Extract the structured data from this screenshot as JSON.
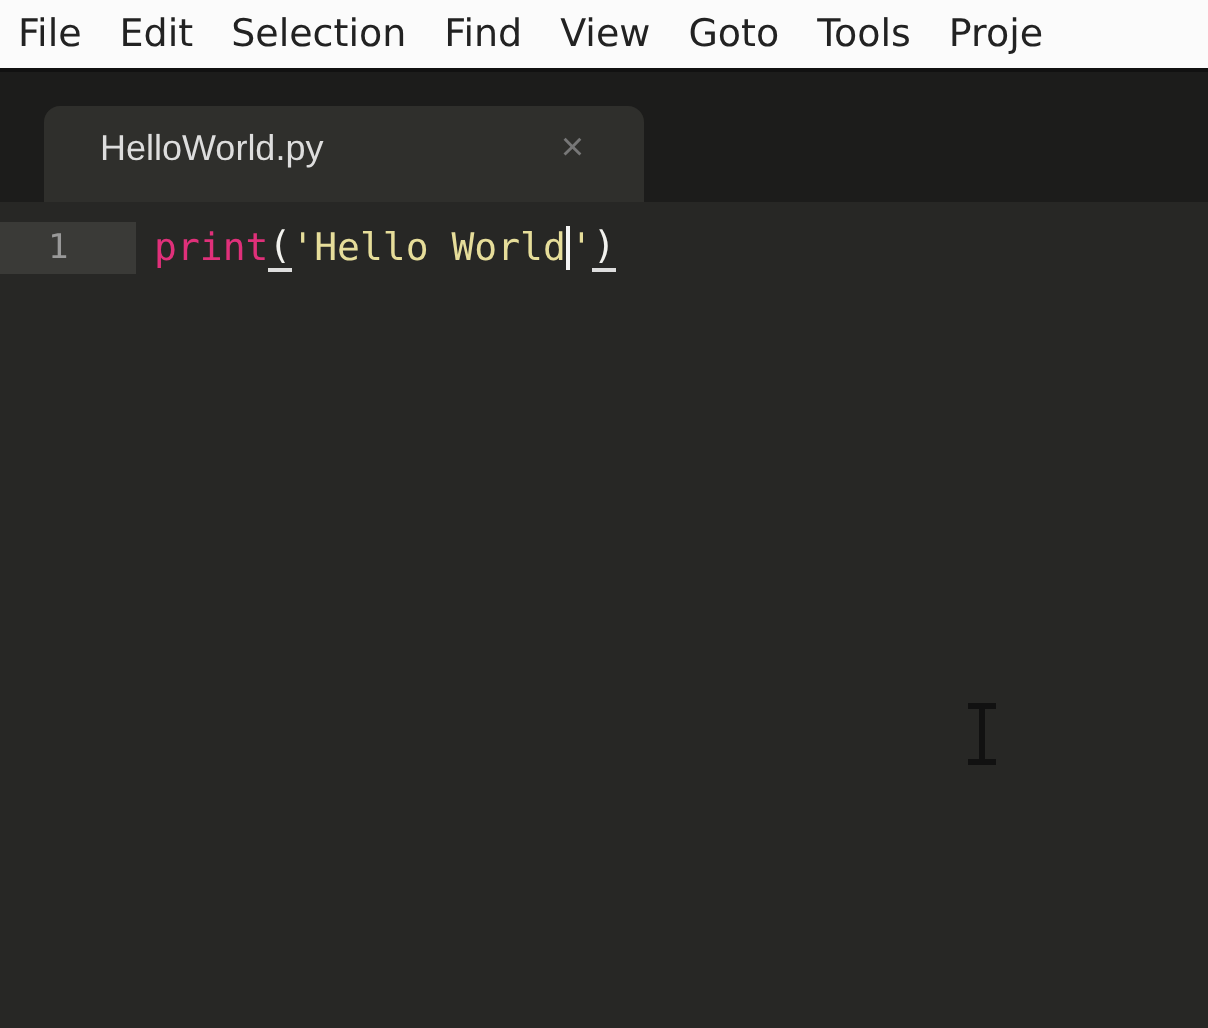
{
  "menu": [
    "File",
    "Edit",
    "Selection",
    "Find",
    "View",
    "Goto",
    "Tools",
    "Proje"
  ],
  "tabs": [
    {
      "label": "HelloWorld.py",
      "close": "×",
      "selected": true
    }
  ],
  "editor": {
    "lines": [
      {
        "number": "1",
        "current": true,
        "tokens": [
          {
            "kind": "function",
            "text": "print"
          },
          {
            "kind": "bracket",
            "text": "(",
            "matched": true
          },
          {
            "kind": "string",
            "text": "'Hello World"
          },
          {
            "kind": "caret"
          },
          {
            "kind": "string",
            "text": "'"
          },
          {
            "kind": "bracket",
            "text": ")",
            "matched": true
          }
        ]
      }
    ]
  }
}
